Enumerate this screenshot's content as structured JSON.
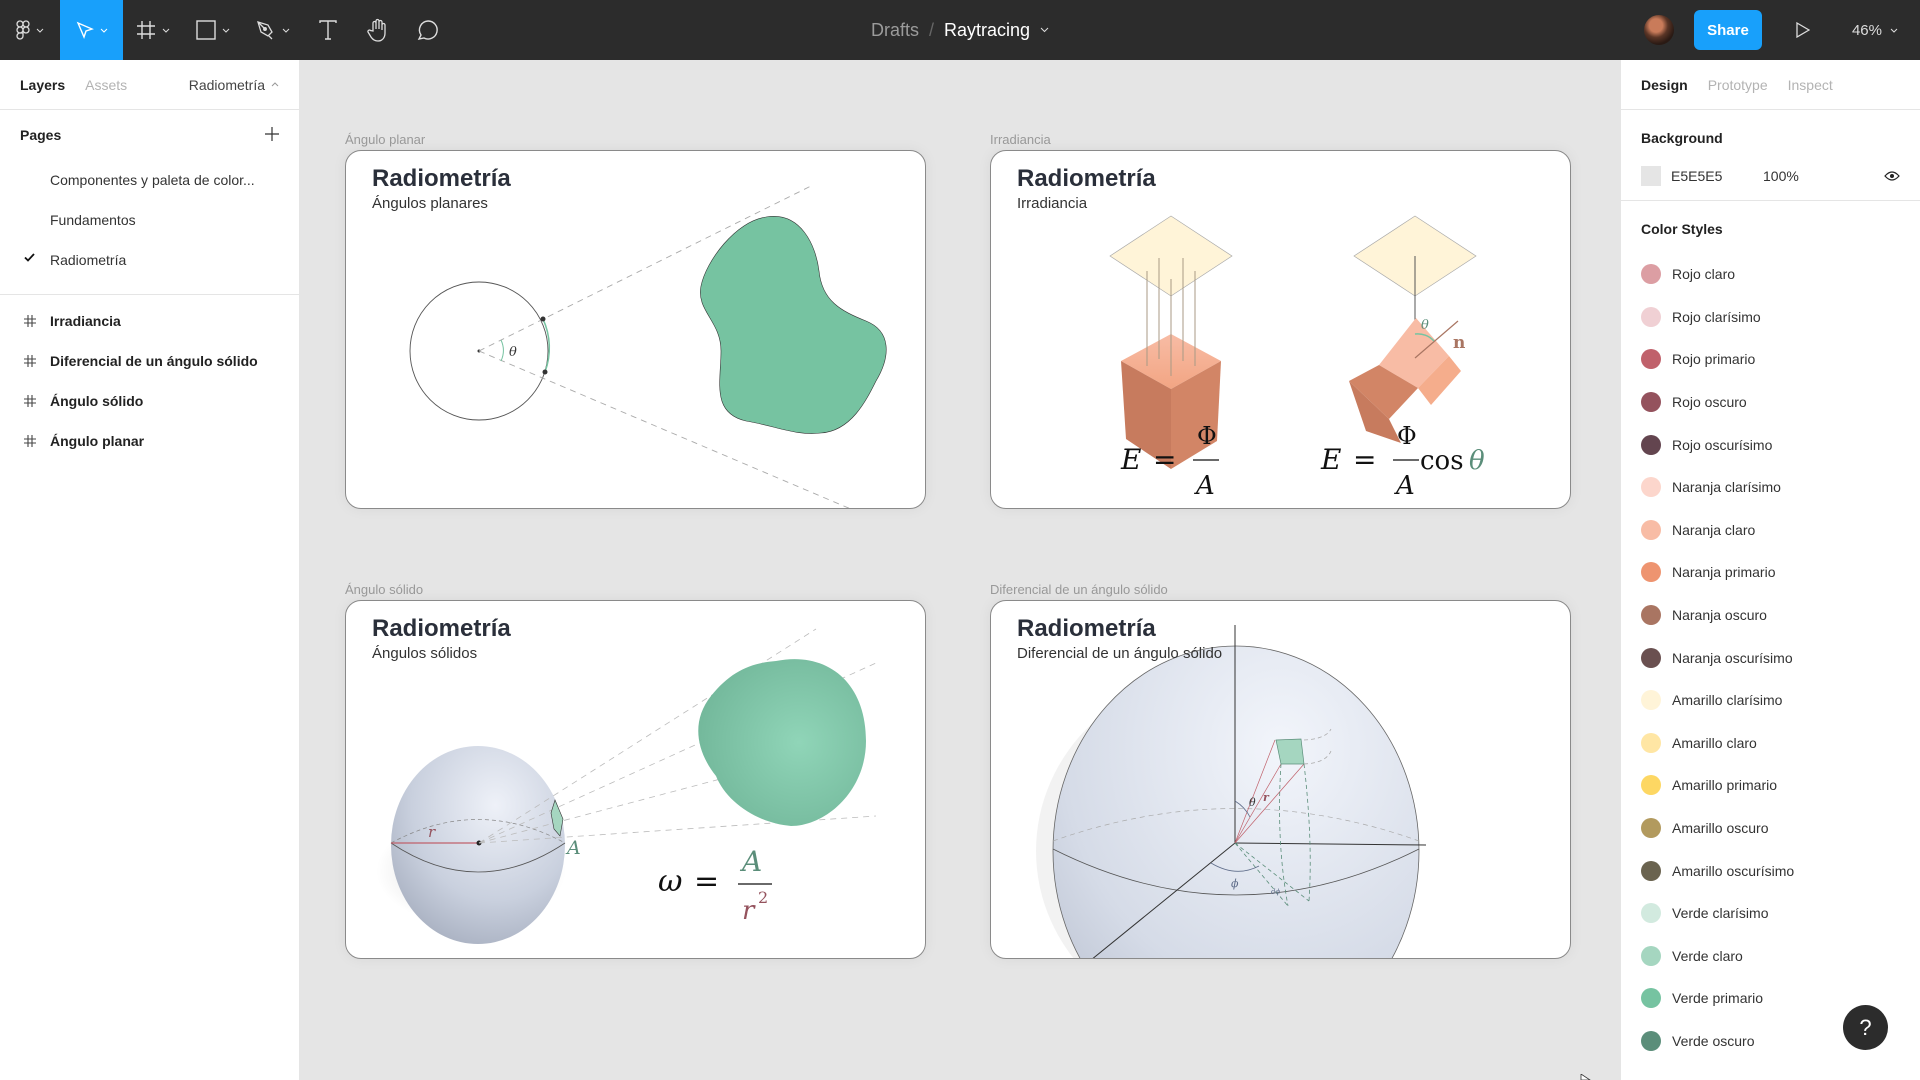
{
  "toolbar": {
    "tools": [
      {
        "name": "main-menu",
        "icon": "figma-logo-icon"
      },
      {
        "name": "move",
        "icon": "cursor-arrow-icon",
        "active": true
      },
      {
        "name": "frame",
        "icon": "frame-hash-icon"
      },
      {
        "name": "shape",
        "icon": "rectangle-icon"
      },
      {
        "name": "pen",
        "icon": "pen-nib-icon"
      },
      {
        "name": "text",
        "icon": "text-t-icon"
      },
      {
        "name": "hand",
        "icon": "hand-icon"
      },
      {
        "name": "comment",
        "icon": "speech-bubble-icon"
      }
    ],
    "breadcrumb_parent": "Drafts",
    "breadcrumb_separator": "/",
    "file_name": "Raytracing",
    "share_label": "Share",
    "zoom_level": "46%",
    "accent_color": "#18A0FB"
  },
  "left_panel": {
    "tabs": [
      {
        "label": "Layers",
        "active": true
      },
      {
        "label": "Assets",
        "active": false
      }
    ],
    "current_page": "Radiometría",
    "pages_title": "Pages",
    "pages": [
      {
        "label": "Componentes y paleta de color...",
        "selected": false
      },
      {
        "label": "Fundamentos",
        "selected": false
      },
      {
        "label": "Radiometría",
        "selected": true
      }
    ],
    "layers": [
      {
        "label": "Irradiancia",
        "type": "frame"
      },
      {
        "label": "Diferencial de un ángulo sólido",
        "type": "frame"
      },
      {
        "label": "Ángulo sólido",
        "type": "frame"
      },
      {
        "label": "Ángulo planar",
        "type": "frame"
      }
    ]
  },
  "right_panel": {
    "tabs": [
      {
        "label": "Design",
        "active": true
      },
      {
        "label": "Prototype",
        "active": false
      },
      {
        "label": "Inspect",
        "active": false
      }
    ],
    "background": {
      "title": "Background",
      "hex": "E5E5E5",
      "opacity": "100%",
      "visible": true
    },
    "color_styles_title": "Color Styles",
    "color_styles": [
      {
        "name": "Rojo claro",
        "color": "#DC9EA3"
      },
      {
        "name": "Rojo clarísimo",
        "color": "#F0D0D4"
      },
      {
        "name": "Rojo primario",
        "color": "#C0616B"
      },
      {
        "name": "Rojo oscuro",
        "color": "#94525D"
      },
      {
        "name": "Rojo oscurísimo",
        "color": "#63454F"
      },
      {
        "name": "Naranja clarísimo",
        "color": "#FCD6CC"
      },
      {
        "name": "Naranja claro",
        "color": "#F8BCA5"
      },
      {
        "name": "Naranja primario",
        "color": "#EE9470"
      },
      {
        "name": "Naranja oscuro",
        "color": "#A97562"
      },
      {
        "name": "Naranja oscurísimo",
        "color": "#6A5050"
      },
      {
        "name": "Amarillo clarísimo",
        "color": "#FFF4D8"
      },
      {
        "name": "Amarillo claro",
        "color": "#FFE6A4"
      },
      {
        "name": "Amarillo primario",
        "color": "#FDD763"
      },
      {
        "name": "Amarillo oscuro",
        "color": "#B29A5E"
      },
      {
        "name": "Amarillo oscurísimo",
        "color": "#6A634F"
      },
      {
        "name": "Verde clarísimo",
        "color": "#D2EADF"
      },
      {
        "name": "Verde claro",
        "color": "#A5D6C0"
      },
      {
        "name": "Verde primario",
        "color": "#76C3A1"
      },
      {
        "name": "Verde oscuro",
        "color": "#5B8E7A"
      }
    ],
    "help_label": "?"
  },
  "canvas": {
    "frames": [
      {
        "label": "Ángulo planar",
        "title": "Radiometría",
        "subtitle": "Ángulos planares",
        "annotations": {
          "theta": "θ"
        }
      },
      {
        "label": "Irradiancia",
        "title": "Radiometría",
        "subtitle": "Irradiancia",
        "annotations": {
          "theta": "θ",
          "normal": "n"
        },
        "formulas": [
          {
            "lhs": "E",
            "eq": "=",
            "num": "Φ",
            "den": "A",
            "tail": ""
          },
          {
            "lhs": "E",
            "eq": "=",
            "num": "Φ",
            "den": "A",
            "tail": "cos",
            "tail_var": "θ"
          }
        ]
      },
      {
        "label": "Ángulo sólido",
        "title": "Radiometría",
        "subtitle": "Ángulos sólidos",
        "annotations": {
          "radius": "r",
          "area": "A"
        },
        "formula": {
          "lhs": "ω",
          "eq": "=",
          "num": "A",
          "den": "r",
          "den_exp": "2"
        }
      },
      {
        "label": "Diferencial de un ángulo sólido",
        "title": "Radiometría",
        "subtitle": "Diferencial de un ángulo sólido",
        "annotations": {
          "theta": "θ",
          "radius": "r",
          "phi": "ϕ",
          "dphi": "dϕ"
        }
      }
    ],
    "colors": {
      "green": "#76C3A1",
      "orange": "#E89570",
      "yellow_light": "#FFF4D8",
      "red_dark": "#94525D",
      "sphere": "#D4DAE6"
    }
  }
}
